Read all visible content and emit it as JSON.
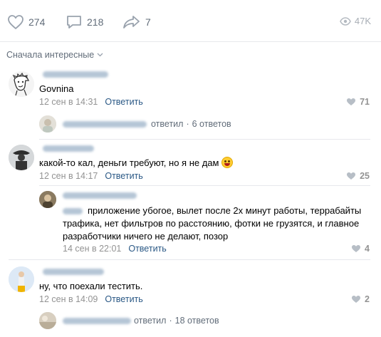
{
  "stats": {
    "likes": "274",
    "comments": "218",
    "shares": "7",
    "views": "47K"
  },
  "sort": {
    "label": "Сначала интересные"
  },
  "comments": [
    {
      "text": "Govnina",
      "date": "12 сен в 14:31",
      "reply_label": "Ответить",
      "likes": "71",
      "thread": {
        "action": "ответил",
        "count": "6 ответов"
      }
    },
    {
      "text": "какой-то кал, деньги требуют, но я не дам",
      "date": "12 сен в 14:17",
      "reply_label": "Ответить",
      "likes": "25",
      "reply": {
        "text_line1": "приложение убогое, вылет после 2х минут работы, террабайты",
        "text_line2": "трафика, нет фильтров по расстоянию, фотки не грузятся, и главное",
        "text_line3": "разработчики ничего не делают, позор",
        "date": "14 сен в 22:01",
        "reply_label": "Ответить",
        "likes": "4"
      }
    },
    {
      "text": "ну, что поехали тестить.",
      "date": "12 сен в 14:09",
      "reply_label": "Ответить",
      "likes": "2",
      "thread": {
        "action": "ответил",
        "count": "18 ответов"
      }
    }
  ],
  "colors": {
    "link": "#2a5885",
    "muted": "#939393",
    "divider": "#e7e8ec"
  }
}
